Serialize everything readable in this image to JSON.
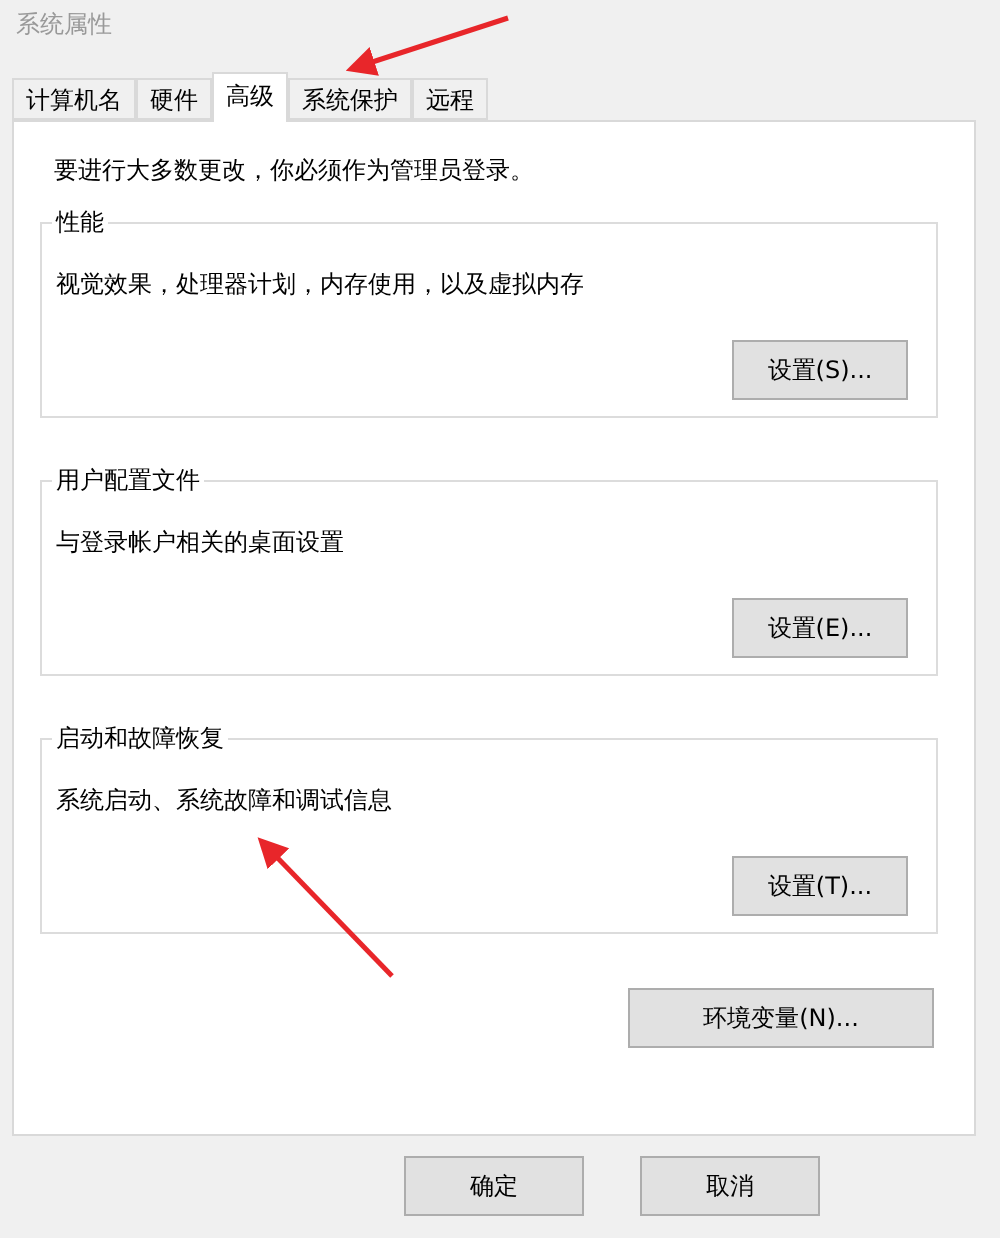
{
  "window": {
    "title": "系统属性"
  },
  "tabs": [
    {
      "label": "计算机名",
      "selected": false
    },
    {
      "label": "硬件",
      "selected": false
    },
    {
      "label": "高级",
      "selected": true
    },
    {
      "label": "系统保护",
      "selected": false
    },
    {
      "label": "远程",
      "selected": false
    }
  ],
  "notice": "要进行大多数更改，你必须作为管理员登录。",
  "groups": [
    {
      "title": "性能",
      "description": "视觉效果，处理器计划，内存使用，以及虚拟内存",
      "button": "设置(S)..."
    },
    {
      "title": "用户配置文件",
      "description": "与登录帐户相关的桌面设置",
      "button": "设置(E)..."
    },
    {
      "title": "启动和故障恢复",
      "description": "系统启动、系统故障和调试信息",
      "button": "设置(T)..."
    }
  ],
  "env_button": "环境变量(N)...",
  "buttons": [
    "确定",
    "取消"
  ]
}
